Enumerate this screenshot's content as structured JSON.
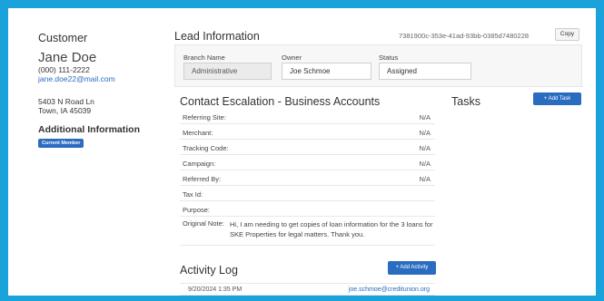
{
  "customer": {
    "header": "Customer",
    "name": "Jane Doe",
    "phone": "(000) 111-2222",
    "email": "jane.doe22@mail.com",
    "address_line1": "5403 N Road Ln",
    "address_line2": "Town, IA 45039",
    "additional_header": "Additional Information",
    "badge": "Current Member"
  },
  "lead": {
    "title": "Lead Information",
    "id": "7381900c-353e-41ad-93bb-0385d7480228",
    "copy_label": "Copy",
    "branch_label": "Branch Name",
    "branch_value": "Administrative",
    "owner_label": "Owner",
    "owner_value": "Joe Schmoe",
    "status_label": "Status",
    "status_value": "Assigned"
  },
  "escalation": {
    "title": "Contact Escalation - Business Accounts",
    "rows": [
      {
        "label": "Referring Site:",
        "value": "N/A"
      },
      {
        "label": "Merchant:",
        "value": "N/A"
      },
      {
        "label": "Tracking Code:",
        "value": "N/A"
      },
      {
        "label": "Campaign:",
        "value": "N/A"
      },
      {
        "label": "Referred By:",
        "value": "N/A"
      },
      {
        "label": "Tax Id:",
        "value": ""
      },
      {
        "label": "Purpose:",
        "value": ""
      }
    ],
    "note_label": "Original Note:",
    "note_value": "Hi, I am needing to get copies of loan information for the 3 loans for SKE Properties for legal matters. Thank you."
  },
  "tasks": {
    "title": "Tasks",
    "add_label": "+ Add Task"
  },
  "activity": {
    "title": "Activity Log",
    "add_label": "+ Add Activity",
    "entries": [
      {
        "date": "9/20/2024 1:35 PM",
        "user": "joe.schmoe@creditunion.org"
      }
    ]
  },
  "colors": {
    "frame": "#1aa3db",
    "accent": "#2a6cc0"
  }
}
